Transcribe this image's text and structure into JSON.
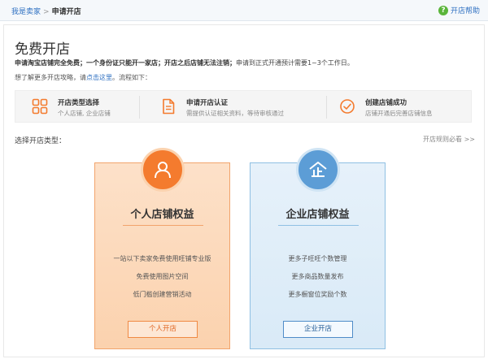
{
  "breadcrumb": {
    "parent": "我是卖家",
    "separator": ">",
    "current": "申请开店"
  },
  "help": {
    "icon": "help-circle-icon",
    "label": "开店帮助"
  },
  "page": {
    "title": "免费开店",
    "desc_bold": "申请淘宝店铺完全免费；一个身份证只能开一家店；开店之后店铺无法注销；",
    "desc_rest": "申请到正式开通预计需要1~3个工作日。",
    "guide_prefix": "想了解更多开店攻略，请",
    "guide_link": "点击这里",
    "guide_suffix": "。流程如下："
  },
  "steps": [
    {
      "icon": "grid-icon",
      "title": "开店类型选择",
      "desc": "个人店铺, 企业店铺"
    },
    {
      "icon": "document-icon",
      "title": "申请开店认证",
      "desc": "需提供认证相关资料，等待审核通过"
    },
    {
      "icon": "check-circle-icon",
      "title": "创建店铺成功",
      "desc": "店铺开通后完善店铺信息"
    }
  ],
  "section": {
    "choose_label": "选择开店类型：",
    "rules_link": "开店规则必看 >>"
  },
  "personal": {
    "icon": "person-icon",
    "title": "个人店铺权益",
    "lines": [
      "一站以下卖家免费使用旺铺专业版",
      "免费使用图片空间",
      "低门槛创建营销活动"
    ],
    "button": "个人开店"
  },
  "company": {
    "icon": "enterprise-icon",
    "title": "企业店铺权益",
    "lines": [
      "更多子旺旺个数管理",
      "更多商品数量发布",
      "更多橱窗位奖励个数"
    ],
    "button": "企业开店"
  },
  "colors": {
    "orange": "#f47b2e",
    "blue": "#5c9dd6",
    "link": "#2d6fc1"
  }
}
